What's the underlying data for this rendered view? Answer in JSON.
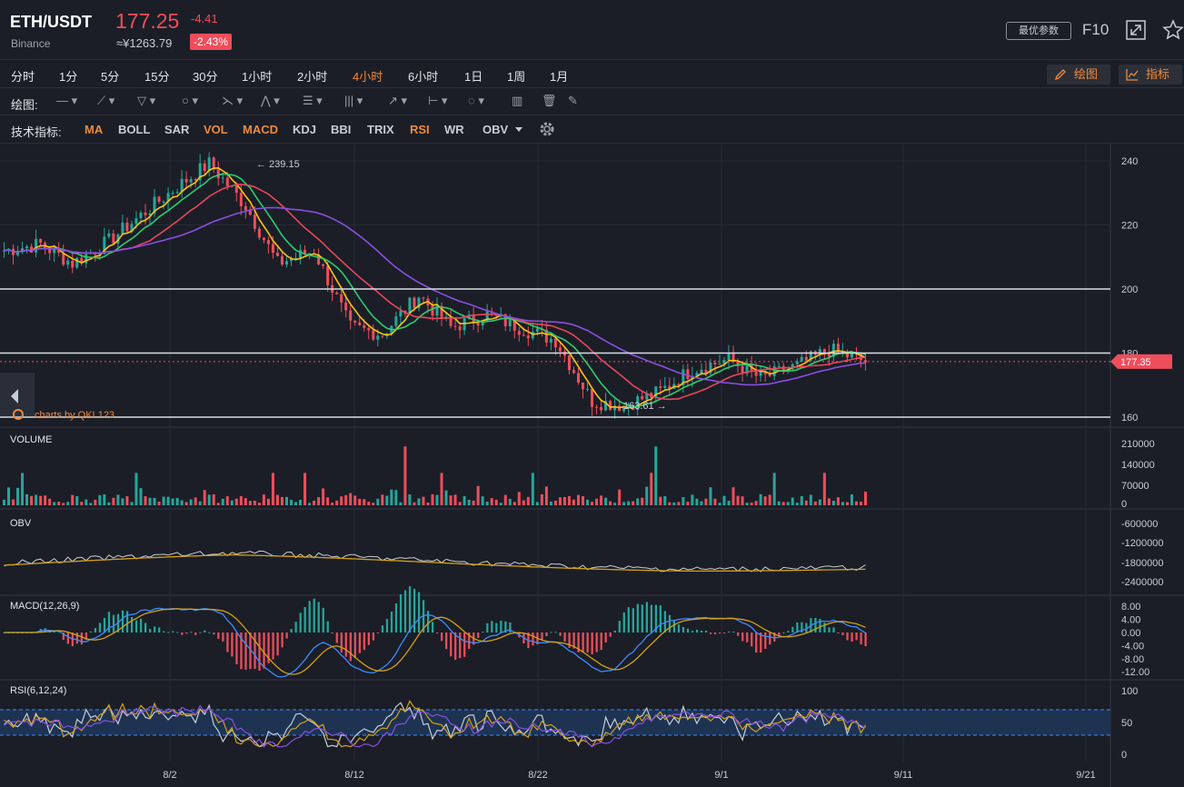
{
  "header": {
    "pair": "ETH/USDT",
    "exchange": "Binance",
    "price": "177.25",
    "change": "-4.41",
    "cny_price": "≈¥1263.79",
    "change_pct": "-2.43%",
    "param_button": "最优参数",
    "f10": "F10",
    "fullscreen_icon": "expand-icon",
    "favorite_icon": "star-icon"
  },
  "timeframes": [
    "分时",
    "1分",
    "5分",
    "15分",
    "30分",
    "1小时",
    "2小时",
    "4小时",
    "6小时",
    "1日",
    "1周",
    "1月"
  ],
  "active_timeframe": "4小时",
  "right_buttons": {
    "draw": "绘图",
    "indicator": "指标"
  },
  "drawing": {
    "label": "绘图:",
    "tools": [
      "line-tool-icon",
      "ray-tool-icon",
      "triangle-tool-icon",
      "circle-tool-icon",
      "path-tool-icon",
      "pattern-tool-icon",
      "fib-tool-icon",
      "channel-tool-icon",
      "arrow-tool-icon",
      "measure-tool-icon",
      "note-tool-icon",
      "magnet-icon",
      "trash-icon",
      "eraser-icon"
    ]
  },
  "indicators": {
    "label": "技术指标:",
    "items": [
      {
        "name": "MA",
        "on": true
      },
      {
        "name": "BOLL",
        "on": false
      },
      {
        "name": "SAR",
        "on": false
      },
      {
        "name": "VOL",
        "on": true
      },
      {
        "name": "MACD",
        "on": true
      },
      {
        "name": "KDJ",
        "on": false
      },
      {
        "name": "BBI",
        "on": false
      },
      {
        "name": "TRIX",
        "on": false
      },
      {
        "name": "RSI",
        "on": true
      },
      {
        "name": "WR",
        "on": false
      },
      {
        "name": "OBV",
        "on": false
      }
    ],
    "settings_icon": "gear-icon"
  },
  "price_pane": {
    "y_ticks": [
      "240",
      "220",
      "200",
      "180",
      "160"
    ],
    "high_label": "← 239.15",
    "low_label": "163.61 →",
    "current_tag": "177.35",
    "watermark": "charts by QKL123",
    "h_levels": [
      200,
      180,
      160
    ]
  },
  "volume_pane": {
    "title": "VOLUME",
    "y_ticks": [
      "210000",
      "140000",
      "70000",
      "0"
    ]
  },
  "obv_pane": {
    "title": "OBV",
    "y_ticks": [
      "-600000",
      "-1200000",
      "-1800000",
      "-2400000"
    ]
  },
  "macd_pane": {
    "title": "MACD(12,26,9)",
    "y_ticks": [
      "8.00",
      "4.00",
      "0.00",
      "-4.00",
      "-8.00",
      "-12.00"
    ]
  },
  "rsi_pane": {
    "title": "RSI(6,12,24)",
    "y_ticks": [
      "100",
      "50",
      "0"
    ]
  },
  "x_ticks": [
    "8/2",
    "8/12",
    "8/22",
    "9/1",
    "9/11",
    "9/21"
  ],
  "colors": {
    "up": "#26a69a",
    "down": "#ef4d5b",
    "accent": "#f08a3c",
    "ma_yellow": "#f5c518",
    "ma_green": "#2ecc71",
    "ma_red": "#e8475a",
    "ma_purple": "#8a4fe0"
  },
  "chart_data": {
    "type": "candlestick",
    "price_series": [
      {
        "date": "7/27",
        "close": 212
      },
      {
        "date": "7/29",
        "close": 214
      },
      {
        "date": "7/31",
        "close": 208
      },
      {
        "date": "8/2",
        "close": 215
      },
      {
        "date": "8/4",
        "close": 223
      },
      {
        "date": "8/6",
        "close": 232
      },
      {
        "date": "8/7",
        "close": 239.15
      },
      {
        "date": "8/9",
        "close": 226
      },
      {
        "date": "8/11",
        "close": 208
      },
      {
        "date": "8/13",
        "close": 212
      },
      {
        "date": "8/15",
        "close": 188
      },
      {
        "date": "8/17",
        "close": 186
      },
      {
        "date": "8/19",
        "close": 198
      },
      {
        "date": "8/21",
        "close": 188
      },
      {
        "date": "8/23",
        "close": 192
      },
      {
        "date": "8/25",
        "close": 188
      },
      {
        "date": "8/27",
        "close": 184
      },
      {
        "date": "8/28",
        "close": 165
      },
      {
        "date": "8/29",
        "close": 163.61
      },
      {
        "date": "8/31",
        "close": 168
      },
      {
        "date": "9/2",
        "close": 175
      },
      {
        "date": "9/4",
        "close": 178
      },
      {
        "date": "9/5",
        "close": 172
      },
      {
        "date": "9/7",
        "close": 176
      },
      {
        "date": "9/9",
        "close": 181
      },
      {
        "date": "9/10",
        "close": 177.35
      }
    ],
    "high": 239.15,
    "low": 163.61,
    "ylim": [
      158,
      242
    ]
  }
}
